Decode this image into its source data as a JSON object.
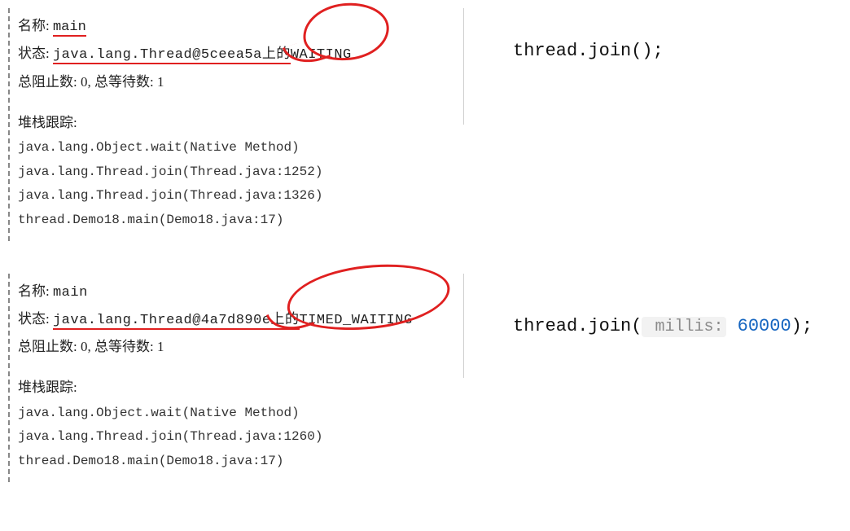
{
  "panels": [
    {
      "name_label": "名称:",
      "name_value": " main",
      "state_label": "状态:",
      "state_value_prefix": " java.lang.Thread@5ceea5a上的",
      "state_value_highlight": "WAITING",
      "counters": "总阻止数: 0, 总等待数: 1",
      "stack_title": "堆栈跟踪:",
      "stack": [
        "java.lang.Object.wait(Native Method)",
        "java.lang.Thread.join(Thread.java:1252)",
        "java.lang.Thread.join(Thread.java:1326)",
        "thread.Demo18.main(Demo18.java:17)"
      ],
      "code_plain": "thread.join();"
    },
    {
      "name_label": "名称:",
      "name_value": "main",
      "state_label": "状态:",
      "state_value_prefix": " java.lang.Thread@4a7d890e上的",
      "state_value_highlight": "TIMED_WAITING",
      "counters": "总阻止数: 0, 总等待数: 1",
      "stack_title": "堆栈跟踪:",
      "stack": [
        "java.lang.Object.wait(Native Method)",
        "java.lang.Thread.join(Thread.java:1260)",
        "thread.Demo18.main(Demo18.java:17)"
      ],
      "code_prefix": "thread.join(",
      "code_param_name": " millis:",
      "code_param_value": " 60000",
      "code_suffix": ");"
    }
  ]
}
